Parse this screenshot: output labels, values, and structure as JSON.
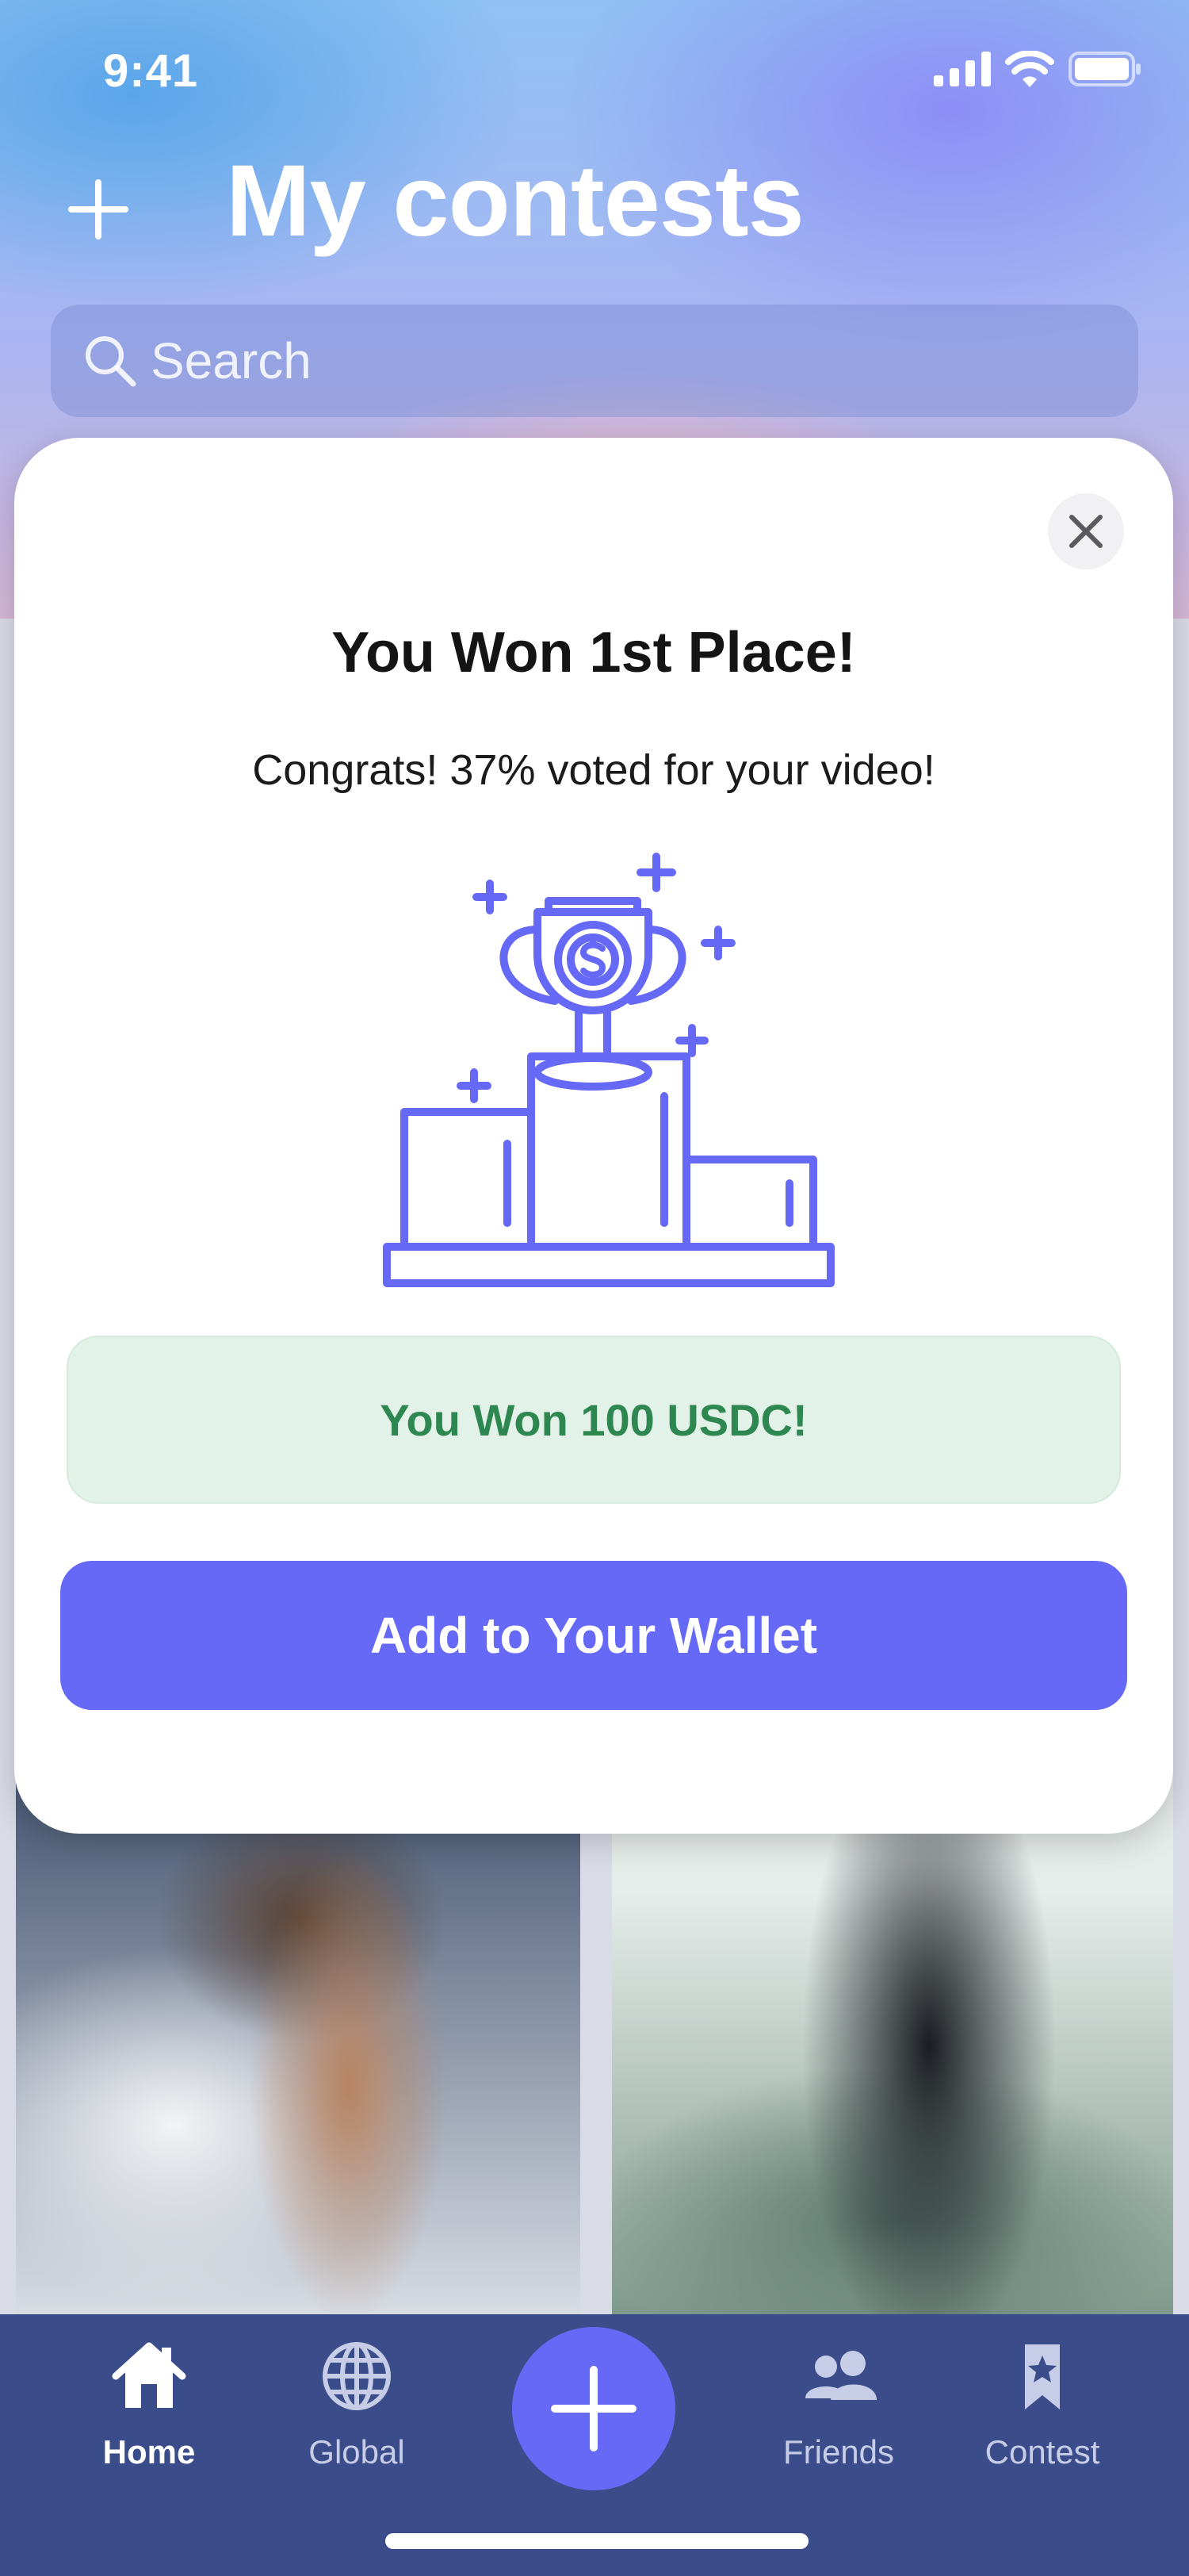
{
  "status_bar": {
    "time": "9:41"
  },
  "header": {
    "title": "My contests"
  },
  "search": {
    "placeholder": "Search"
  },
  "modal": {
    "title": "You Won 1st Place!",
    "subtitle": "Congrats! 37% voted for your video!",
    "prize_text": "You Won 100 USDC!",
    "button_label": "Add to Your Wallet",
    "illustration": "trophy-podium-icon"
  },
  "tab_bar": {
    "items": [
      {
        "label": "Home",
        "icon": "home-icon",
        "active": true
      },
      {
        "label": "Global",
        "icon": "globe-icon",
        "active": false
      },
      {
        "label": "Friends",
        "icon": "friends-icon",
        "active": false
      },
      {
        "label": "Contest",
        "icon": "ribbon-star-icon",
        "active": false
      }
    ],
    "fab_icon": "plus-icon"
  },
  "colors": {
    "accent": "#6669f5",
    "prize_text": "#2e8750",
    "prize_bg": "#e2f2e8",
    "tab_bar_bg": "#3b4c8a"
  }
}
